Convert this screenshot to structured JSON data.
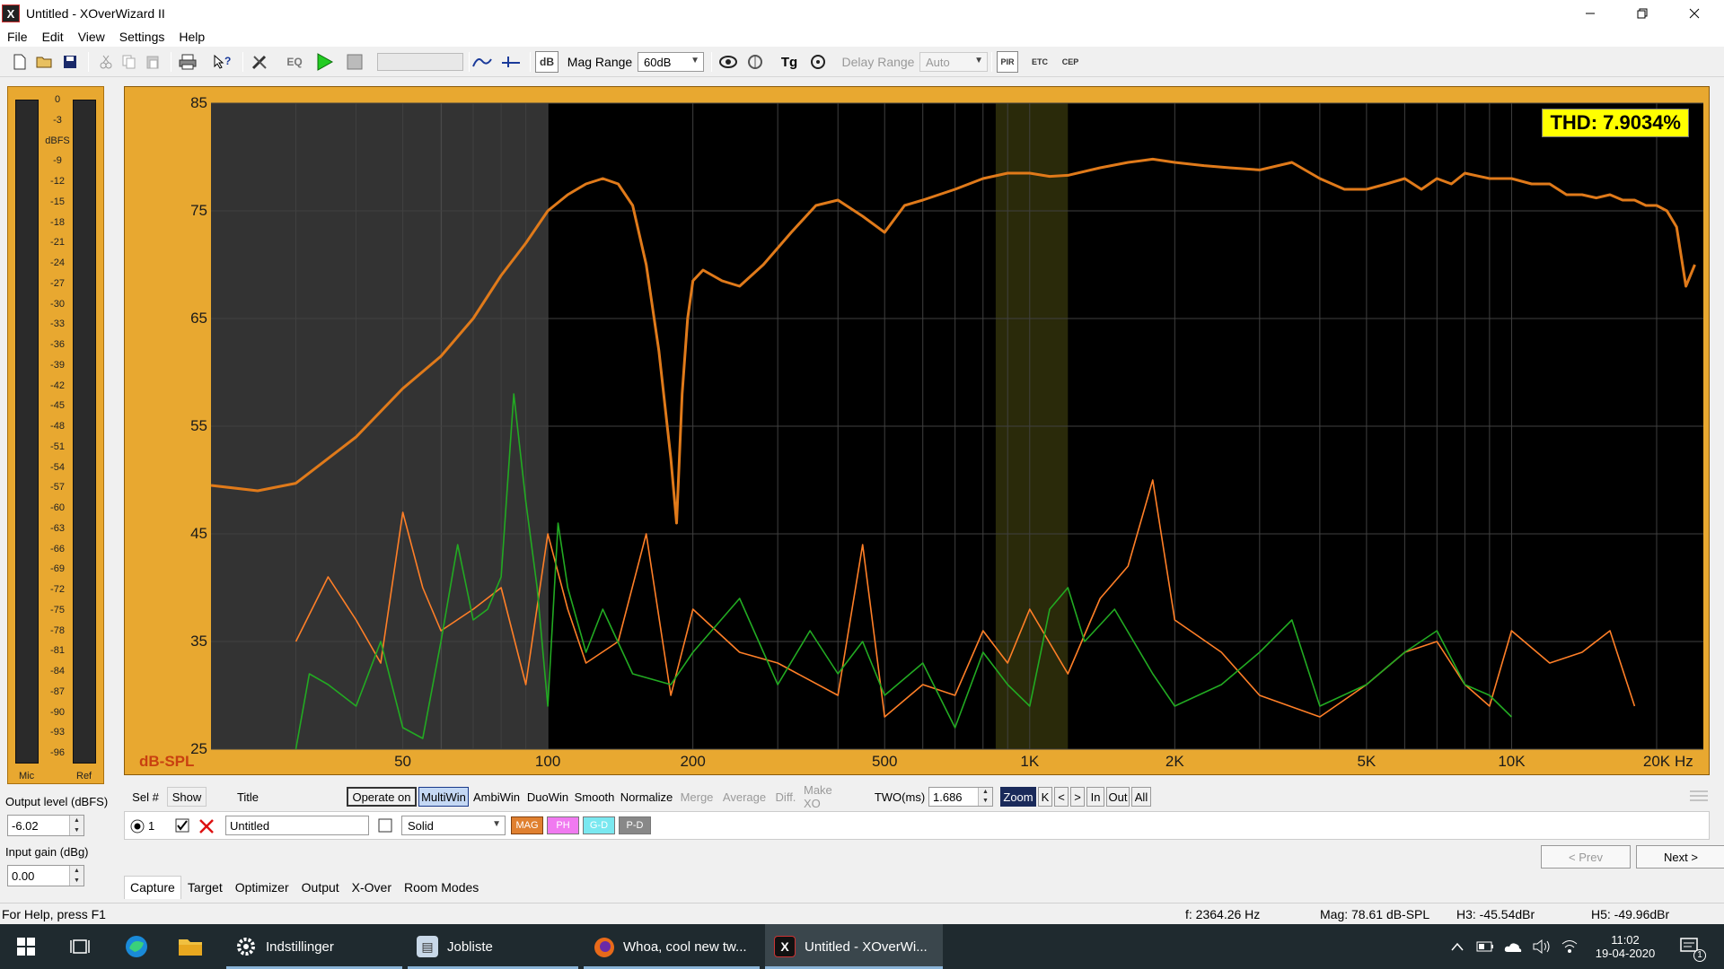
{
  "window": {
    "title": "Untitled - XOverWizard II",
    "app_icon": "X"
  },
  "menu": [
    "File",
    "Edit",
    "View",
    "Settings",
    "Help"
  ],
  "toolbar": {
    "eq_label": "EQ",
    "db_label": "dB",
    "mag_range_label": "Mag Range",
    "mag_range_value": "60dB",
    "tg_label": "Tg",
    "delay_range_label": "Delay Range",
    "delay_range_value": "Auto",
    "pir_label": "PIR",
    "etc_label": "ETC",
    "cep_label": "CEP"
  },
  "meter": {
    "scale": [
      "0",
      "-3",
      "dBFS",
      "-9",
      "-12",
      "-15",
      "-18",
      "-21",
      "-24",
      "-27",
      "-30",
      "-33",
      "-36",
      "-39",
      "-42",
      "-45",
      "-48",
      "-51",
      "-54",
      "-57",
      "-60",
      "-63",
      "-66",
      "-69",
      "-72",
      "-75",
      "-78",
      "-81",
      "-84",
      "-87",
      "-90",
      "-93",
      "-96"
    ],
    "left_label": "Mic",
    "right_label": "Ref"
  },
  "output": {
    "level_label": "Output level (dBFS)",
    "level_value": "-6.02",
    "gain_label": "Input gain (dBg)",
    "gain_value": "0.00"
  },
  "graph": {
    "thd": "THD: 7.9034%",
    "y_unit": "dB-SPL",
    "x_unit": "Hz",
    "y_ticks": [
      "85",
      "75",
      "65",
      "55",
      "45",
      "35",
      "25"
    ],
    "x_ticks": [
      "50",
      "100",
      "200",
      "500",
      "1K",
      "2K",
      "5K",
      "10K",
      "20K"
    ],
    "colors": {
      "frame": "#e8a830",
      "plot_bg": "#000000",
      "window_shade": "#333333",
      "highlight": "#2a2a0a",
      "fundamental": "#e07a1a",
      "h2": "#ff7f27",
      "h3": "#22aa22",
      "grid": "#404040"
    }
  },
  "chart_data": {
    "type": "line",
    "xscale": "log",
    "xlim": [
      20,
      25000
    ],
    "ylim": [
      25,
      85
    ],
    "xlabel": "Hz",
    "ylabel": "dB-SPL",
    "series": [
      {
        "x": [
          20,
          25,
          30,
          40,
          50,
          60,
          70,
          80,
          90,
          100,
          110,
          120,
          130,
          140,
          150,
          160,
          170,
          180,
          185,
          190,
          195,
          200,
          210,
          230,
          250,
          280,
          320,
          360,
          400,
          450,
          500,
          550,
          600,
          700,
          800,
          900,
          1000,
          1100,
          1200,
          1400,
          1600,
          1800,
          2000,
          2300,
          2600,
          3000,
          3500,
          4000,
          4500,
          5000,
          5500,
          6000,
          6500,
          7000,
          7500,
          8000,
          9000,
          10000,
          11000,
          12000,
          13000,
          14000,
          15000,
          16000,
          17000,
          18000,
          19000,
          20000,
          21000,
          22000,
          23000,
          24000
        ],
        "y": [
          49.5,
          49,
          49.7,
          54,
          58.5,
          61.5,
          65,
          69,
          72,
          75,
          76.5,
          77.5,
          78,
          77.5,
          75.5,
          70,
          62,
          52,
          46,
          58,
          65,
          68.5,
          69.5,
          68.5,
          68,
          70,
          73,
          75.5,
          76,
          74.5,
          73,
          75.5,
          76,
          77,
          78,
          78.5,
          78.5,
          78.2,
          78.3,
          79,
          79.5,
          79.8,
          79.5,
          79.2,
          79,
          78.8,
          79.5,
          78,
          77,
          77,
          77.5,
          78,
          77,
          78,
          77.5,
          78.5,
          78,
          78,
          77.5,
          77.5,
          76.5,
          76.5,
          76.2,
          76.5,
          76,
          76,
          75.5,
          75.5,
          75,
          73.5,
          68,
          70
        ]
      },
      {
        "x": [
          30,
          35,
          40,
          45,
          50,
          55,
          60,
          70,
          80,
          90,
          100,
          110,
          120,
          140,
          160,
          180,
          200,
          250,
          300,
          400,
          450,
          500,
          600,
          700,
          800,
          900,
          1000,
          1200,
          1400,
          1600,
          1800,
          2000,
          2500,
          3000,
          4000,
          5000,
          6000,
          7000,
          8000,
          9000,
          10000,
          12000,
          14000,
          16000,
          18000
        ],
        "y": [
          35,
          41,
          37,
          33,
          47,
          40,
          36,
          38,
          40,
          31,
          45,
          38,
          33,
          35,
          45,
          30,
          38,
          34,
          33,
          30,
          44,
          28,
          31,
          30,
          36,
          33,
          38,
          32,
          39,
          42,
          50,
          37,
          34,
          30,
          28,
          31,
          34,
          35,
          31,
          29,
          36,
          33,
          34,
          36,
          29
        ]
      },
      {
        "x": [
          30,
          32,
          35,
          40,
          45,
          50,
          55,
          60,
          65,
          70,
          75,
          80,
          85,
          90,
          95,
          100,
          105,
          110,
          120,
          130,
          150,
          180,
          200,
          250,
          300,
          350,
          400,
          450,
          500,
          600,
          700,
          800,
          900,
          1000,
          1100,
          1200,
          1300,
          1500,
          1800,
          2000,
          2500,
          3000,
          3500,
          4000,
          5000,
          6000,
          7000,
          8000,
          9000,
          10000
        ],
        "y": [
          25,
          32,
          31,
          29,
          35,
          27,
          26,
          35,
          44,
          37,
          38,
          41,
          58,
          48,
          40,
          29,
          46,
          40,
          34,
          38,
          32,
          31,
          34,
          39,
          31,
          36,
          32,
          35,
          30,
          33,
          27,
          34,
          31,
          29,
          38,
          40,
          35,
          38,
          32,
          29,
          31,
          34,
          37,
          29,
          31,
          34,
          36,
          31,
          30,
          28
        ]
      }
    ]
  },
  "controls": {
    "sel_label": "Sel #",
    "show_label": "Show",
    "title_label": "Title",
    "operate_on": "Operate on",
    "multiwin": "MultiWin",
    "ambiwin": "AmbiWin",
    "duowin": "DuoWin",
    "smooth": "Smooth",
    "normalize": "Normalize",
    "merge": "Merge",
    "average": "Average",
    "diff": "Diff.",
    "make_xo": "Make XO",
    "two_label": "TWO(ms)",
    "two_value": "1.686",
    "zoom": "Zoom",
    "zoom_k": "K",
    "zoom_prev": "<",
    "zoom_next": ">",
    "zoom_in": "In",
    "zoom_out": "Out",
    "zoom_all": "All"
  },
  "curve": {
    "number": "1",
    "title_value": "Untitled",
    "line_style": "Solid",
    "mag": "MAG",
    "ph": "PH",
    "gd": "G-D",
    "pd": "P-D"
  },
  "nav": {
    "prev": "< Prev",
    "next": "Next >"
  },
  "tabs": [
    "Capture",
    "Target",
    "Optimizer",
    "Output",
    "X-Over",
    "Room Modes"
  ],
  "status": {
    "help": "For Help, press F1",
    "freq": "f: 2364.26 Hz",
    "mag": "Mag: 78.61 dB-SPL",
    "h3": "H3: -45.54dBr",
    "h5": "H5: -49.96dBr"
  },
  "taskbar": {
    "items": [
      "Indstillinger",
      "Jobliste",
      "Whoa, cool new tw...",
      "Untitled - XOverWi..."
    ],
    "time": "11:02",
    "date": "19-04-2020",
    "notif_count": "1"
  }
}
